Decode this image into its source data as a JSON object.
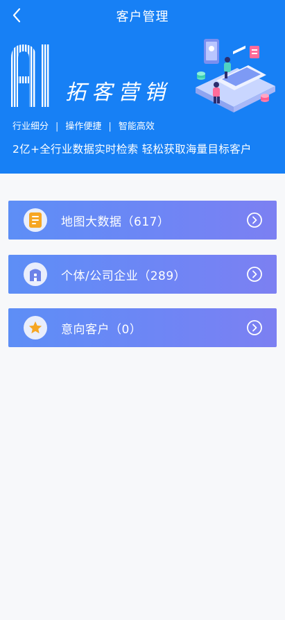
{
  "header": {
    "title": "客户管理",
    "back_icon": "chevron-left-icon",
    "logo_text": "AI",
    "slogan": "拓客营销",
    "features": [
      "行业细分",
      "操作便捷",
      "智能高效"
    ],
    "feature_separator": "|",
    "tagline": "2亿+全行业数据实时检索  轻松获取海量目标客户",
    "background_color": "#1780f5"
  },
  "menu": {
    "items": [
      {
        "label": "地图大数据（617）",
        "icon": "document-icon",
        "arrow_icon": "chevron-right-circle-icon"
      },
      {
        "label": "个体/公司企业（289）",
        "icon": "building-icon",
        "arrow_icon": "chevron-right-circle-icon"
      },
      {
        "label": "意向客户（0）",
        "icon": "star-icon",
        "arrow_icon": "chevron-right-circle-icon"
      }
    ]
  }
}
